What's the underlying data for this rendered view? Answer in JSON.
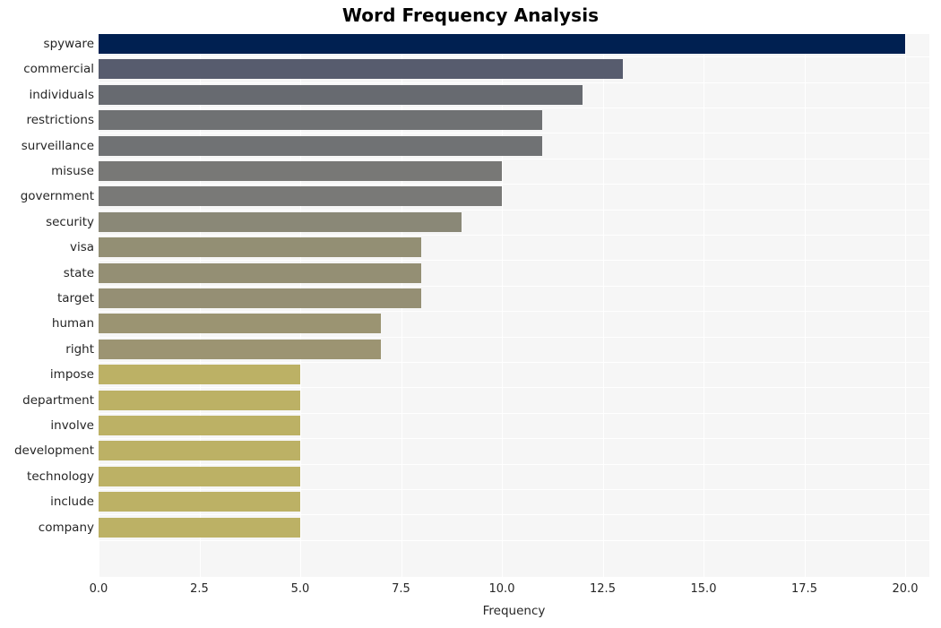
{
  "chart_data": {
    "type": "bar",
    "orientation": "horizontal",
    "title": "Word Frequency Analysis",
    "xlabel": "Frequency",
    "ylabel": "",
    "xlim": [
      0,
      20.6
    ],
    "xticks": [
      0.0,
      2.5,
      5.0,
      7.5,
      10.0,
      12.5,
      15.0,
      17.5,
      20.0
    ],
    "xticklabels": [
      "0.0",
      "2.5",
      "5.0",
      "7.5",
      "10.0",
      "12.5",
      "15.0",
      "17.5",
      "20.0"
    ],
    "grid": true,
    "grid_color": "#ffffff",
    "plot_background": "#f6f6f6",
    "figure_background": "#ffffff",
    "legend": null,
    "categories": [
      "spyware",
      "commercial",
      "individuals",
      "restrictions",
      "surveillance",
      "misuse",
      "government",
      "security",
      "visa",
      "state",
      "target",
      "human",
      "right",
      "impose",
      "department",
      "involve",
      "development",
      "technology",
      "include",
      "company"
    ],
    "values": [
      20,
      13,
      12,
      11,
      11,
      10,
      10,
      9,
      8,
      8,
      8,
      7,
      7,
      5,
      5,
      5,
      5,
      5,
      5,
      5
    ],
    "bar_colors": [
      "#002051",
      "#575c6e",
      "#676a70",
      "#6f7173",
      "#707274",
      "#787876",
      "#797977",
      "#8a8877",
      "#938f74",
      "#948f74",
      "#958f74",
      "#9b9472",
      "#9c9472",
      "#bcb165",
      "#bcb165",
      "#bcb165",
      "#bcb165",
      "#bcb165",
      "#bcb165",
      "#bcb165"
    ]
  }
}
